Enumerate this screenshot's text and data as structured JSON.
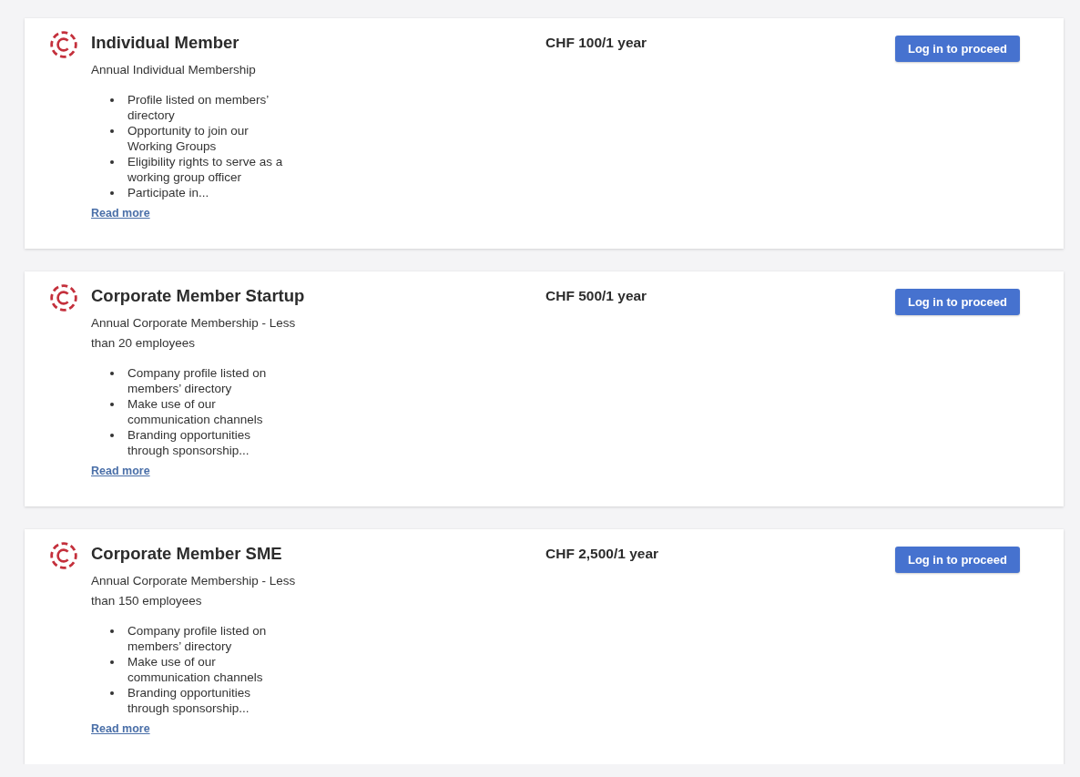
{
  "plans": [
    {
      "title": "Individual Member",
      "description": "Annual Individual Membership",
      "benefits": [
        "Profile listed on members’ directory",
        "Opportunity to join our Working Groups",
        "Eligibility rights to serve as a working group officer",
        "Participate in..."
      ],
      "link": "Read more",
      "price": "CHF 100/1 year",
      "button": "Log in to proceed"
    },
    {
      "title": "Corporate Member Startup",
      "description": "Annual Corporate Membership - Less than 20 employees",
      "benefits": [
        "Company profile listed on members’ directory",
        "Make use of our communication channels",
        "Branding opportunities through sponsorship..."
      ],
      "link": "Read more",
      "price": "CHF 500/1 year",
      "button": "Log in to proceed"
    },
    {
      "title": "Corporate Member SME",
      "description": "Annual Corporate Membership - Less than 150 employees",
      "benefits": [
        "Company profile listed on members’ directory",
        "Make use of our communication channels",
        "Branding opportunities through sponsorship..."
      ],
      "link": "Read more",
      "price": "CHF 2,500/1 year",
      "button": "Log in to proceed"
    }
  ]
}
